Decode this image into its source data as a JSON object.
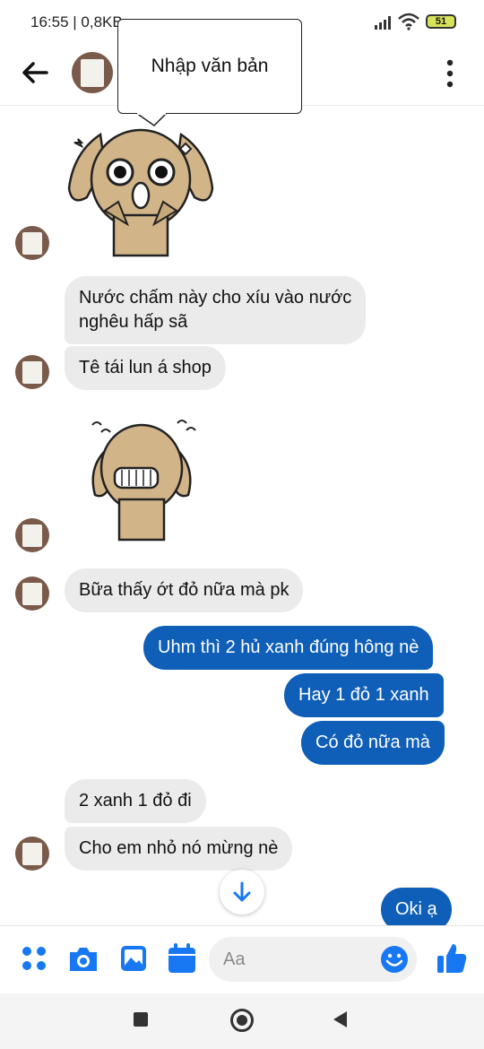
{
  "status_bar": {
    "time_speed": "16:55 | 0,8KB",
    "battery": "51"
  },
  "tooltip": {
    "text": "Nhập văn bản"
  },
  "messages": [
    {
      "text": "Nước chấm này cho xíu vào nước",
      "text2": "nghêu hấp sã"
    },
    {
      "text": "Tê tái lun á shop"
    },
    {
      "text": "Bữa thấy ớt đỏ nữa mà pk"
    },
    {
      "text": "Uhm thì 2 hủ xanh đúng hông nè"
    },
    {
      "text": "Hay 1 đỏ 1 xanh"
    },
    {
      "text": "Có đỏ nữa mà"
    },
    {
      "text": "2 xanh 1 đỏ đi"
    },
    {
      "text": "Cho em nhỏ nó mừng nè"
    },
    {
      "text": "Oki ạ"
    }
  ],
  "composer": {
    "placeholder": "Aa"
  },
  "colors": {
    "outgoing": "#0f5fb8",
    "incoming": "#ebebeb",
    "accent": "#1877f2"
  },
  "icons": [
    "back-arrow-icon",
    "more-vertical-icon",
    "apps-icon",
    "camera-icon",
    "image-icon",
    "calendar-icon",
    "emoji-icon",
    "like-icon",
    "scroll-down-icon",
    "nav-recents-icon",
    "nav-home-icon",
    "nav-back-icon"
  ]
}
